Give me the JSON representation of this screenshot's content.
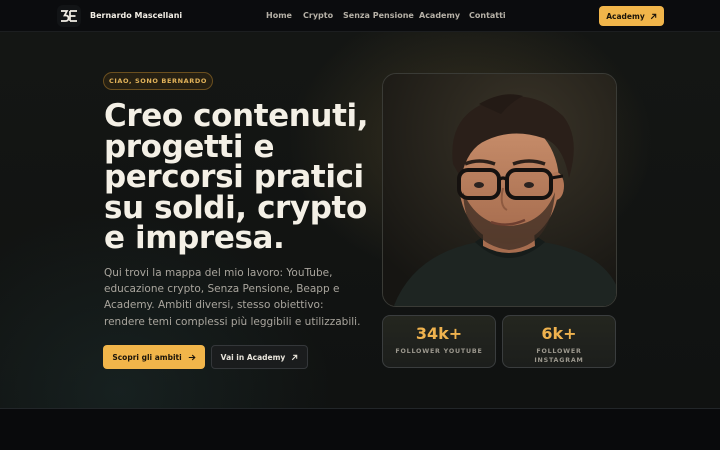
{
  "nav": {
    "brand_name": "Bernardo Mascellani",
    "links": [
      "Home",
      "Crypto",
      "Senza Pensione",
      "Academy",
      "Contatti"
    ],
    "cta_label": "Academy"
  },
  "hero": {
    "eyebrow": "CIAO, SONO BERNARDO",
    "headline": "Creo contenuti, progetti e percorsi pratici su soldi, crypto e impresa.",
    "intro": "Qui trovi la mappa del mio lavoro: YouTube, educazione crypto, Senza Pensione, Beapp e Academy. Ambiti diversi, stesso obiettivo: rendere temi complessi più leggibili e utilizzabili.",
    "primary_button": "Scopri gli ambiti",
    "secondary_button": "Vai in Academy"
  },
  "stats": [
    {
      "value": "34k+",
      "label": "FOLLOWER YOUTUBE"
    },
    {
      "value": "6k+",
      "label": "FOLLOWER INSTAGRAM"
    }
  ],
  "icons": {
    "logo": "be-monogram-logo",
    "external": "arrow-up-right-icon",
    "forward": "arrow-right-icon"
  },
  "colors": {
    "accent": "#f1b54a",
    "background": "#0b0d0f",
    "stat_value": "#efb24e"
  }
}
